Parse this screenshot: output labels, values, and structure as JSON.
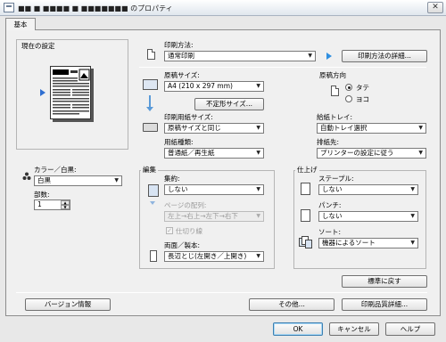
{
  "window": {
    "title": "■■ ■ ■■■■ ■ ■■■■■■■ のプロパティ",
    "close_label": "✕"
  },
  "tabs": [
    {
      "label": "基本"
    }
  ],
  "preview": {
    "heading": "現在の設定"
  },
  "color": {
    "label": "カラー／白黒:",
    "value": "白黒"
  },
  "copies": {
    "label": "部数:",
    "value": "1"
  },
  "print_method": {
    "label": "印刷方法:",
    "value": "通常印刷",
    "detail_button": "印刷方法の詳細..."
  },
  "paper_size": {
    "label": "原稿サイズ:",
    "value": "A4 (210 x 297 mm)",
    "custom_button": "不定形サイズ..."
  },
  "orientation": {
    "label": "原稿方向",
    "portrait": "タテ",
    "landscape": "ヨコ",
    "selected": "portrait"
  },
  "output_size": {
    "label": "印刷用紙サイズ:",
    "value": "原稿サイズと同じ"
  },
  "paper_tray": {
    "label": "給紙トレイ:",
    "value": "自動トレイ選択"
  },
  "paper_type": {
    "label": "用紙種類:",
    "value": "普通紙／再生紙"
  },
  "output_tray": {
    "label": "排紙先:",
    "value": "プリンターの設定に従う"
  },
  "edit": {
    "heading": "編集",
    "nup_label": "集約:",
    "nup_value": "しない",
    "order_label": "ページの配列:",
    "order_value": "左上→右上→左下→右下",
    "border_label": "仕切り線",
    "duplex_label": "両面／製本:",
    "duplex_value": "長辺とじ(左開き／上開き)"
  },
  "finishing": {
    "heading": "仕上げ",
    "staple_label": "ステープル:",
    "staple_value": "しない",
    "punch_label": "パンチ:",
    "punch_value": "しない",
    "sort_label": "ソート:",
    "sort_value": "機器によるソート"
  },
  "buttons": {
    "restore_defaults": "標準に戻す",
    "version_info": "バージョン情報",
    "other": "その他...",
    "print_quality": "印刷品質詳細...",
    "ok": "OK",
    "cancel": "キャンセル",
    "help": "ヘルプ"
  }
}
